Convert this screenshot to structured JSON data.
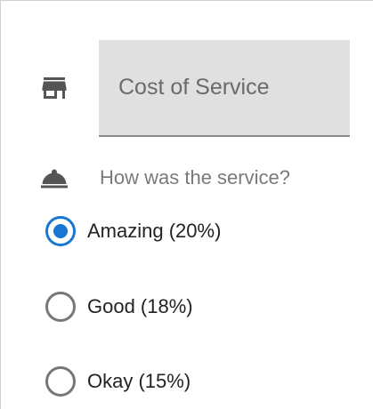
{
  "cost": {
    "placeholder": "Cost of Service",
    "value": "",
    "icon": "storefront-icon"
  },
  "service": {
    "question": "How was the service?",
    "icon": "room-service-bell-icon",
    "selected_index": 0,
    "options": [
      {
        "label": "Amazing (20%)",
        "checked": true
      },
      {
        "label": "Good (18%)",
        "checked": false
      },
      {
        "label": "Okay (15%)",
        "checked": false
      }
    ]
  },
  "colors": {
    "accent": "#1976d2",
    "field_background": "#e0e0e0",
    "icon": "#555555"
  }
}
